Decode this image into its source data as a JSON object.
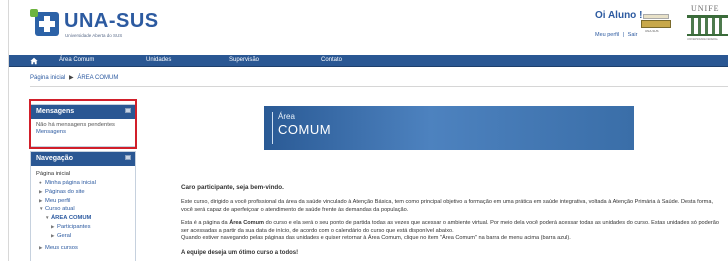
{
  "header": {
    "logo_text": "UNA-SUS",
    "logo_subtitle": "Universidade Aberta do SUS",
    "greeting": "Oi Aluno !",
    "profile_link": "Meu perfil",
    "separator": "|",
    "logout_link": "Sair",
    "partner_logo_label": "UNA-SUS",
    "university_logo_text": "UNIFE",
    "university_logo_subtitle": "UNIVERSIDADE FEDERAL"
  },
  "nav": {
    "items": [
      "Área Comum",
      "Unidades",
      "Supervisão",
      "Contato"
    ]
  },
  "breadcrumb": {
    "items": [
      "Página inicial",
      "ÁREA COMUM"
    ],
    "separator": "▶"
  },
  "messages_block": {
    "title": "Mensagens",
    "body": "Não há mensagens pendentes",
    "link": "Mensagens"
  },
  "navigation_block": {
    "title": "Navegação",
    "root": "Página inicial",
    "items": [
      {
        "label": "Minha página inicial",
        "arrow": "●"
      },
      {
        "label": "Páginas do site",
        "arrow": "▶"
      },
      {
        "label": "Meu perfil",
        "arrow": "▶"
      },
      {
        "label": "Curso atual",
        "arrow": "▼"
      },
      {
        "label": "ÁREA COMUM",
        "arrow": "▼"
      },
      {
        "label": "Participantes",
        "arrow": "▶"
      },
      {
        "label": "Geral",
        "arrow": "▶"
      },
      {
        "label": "Meus cursos",
        "arrow": "▶"
      }
    ]
  },
  "banner": {
    "small": "Área",
    "big": "COMUM"
  },
  "main": {
    "greeting": "Caro participante, seja bem-vindo.",
    "paragraph1": "Este curso, dirigido a você profissional da área da saúde vinculado à Atenção Básica, tem como principal objetivo a formação em uma prática em saúde integrativa, voltada à Atenção Primária à Saúde. Desta forma, você será capaz de aperfeiçoar o atendimento de saúde frente às demandas da população.",
    "paragraph2_prefix": "Esta é a página da ",
    "paragraph2_bold": "Área Comum",
    "paragraph2_rest": " do curso e ela será o seu ponto de partida todas as vezes que acessar o ambiente virtual. Por meio dela você poderá acessar todas as unidades do curso. Estas unidades só poderão ser acessadas a partir da sua data de início, de acordo com o calendário do curso que está disponível abaixo.",
    "paragraph2_last": "Quando estiver navegando pelas páginas das unidades e quiser retornar à Área Comum, clique no item \"Área Comum\" na barra de menu acima (barra azul).",
    "closing": "A equipe deseja um ótimo curso a todos!"
  },
  "colors": {
    "brand_blue": "#2a5793",
    "link_blue": "#2c5aa0",
    "highlight_red": "#d11f2a"
  }
}
